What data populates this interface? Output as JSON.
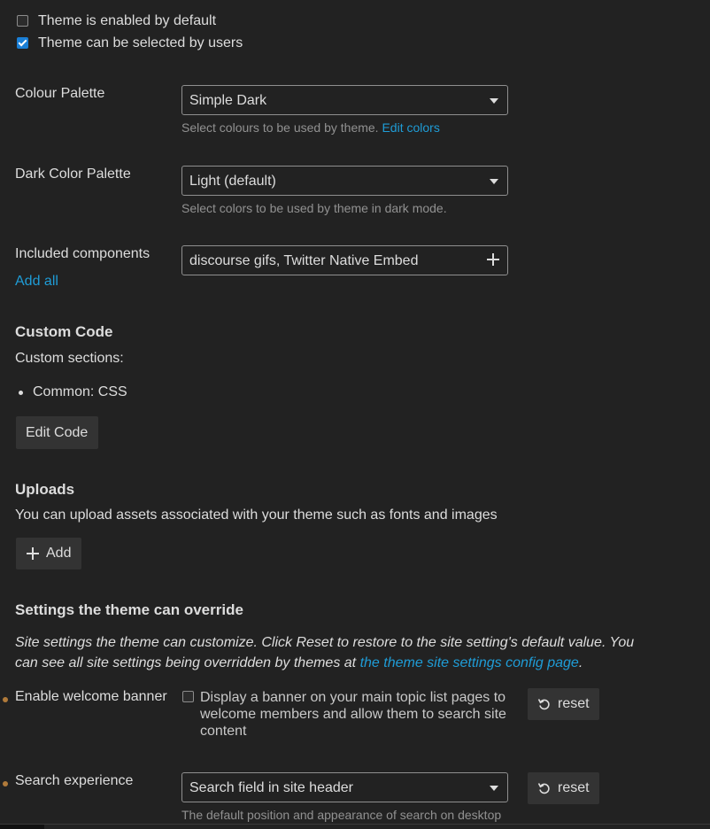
{
  "checkboxes": {
    "enabled_default": {
      "label": "Theme is enabled by default",
      "checked": false
    },
    "selectable": {
      "label": "Theme can be selected by users",
      "checked": true
    }
  },
  "colour_palette": {
    "label": "Colour Palette",
    "value": "Simple Dark",
    "help": "Select colours to be used by theme.",
    "help_link": "Edit colors"
  },
  "dark_palette": {
    "label": "Dark Color Palette",
    "value": "Light (default)",
    "help": "Select colors to be used by theme in dark mode."
  },
  "components": {
    "label": "Included components",
    "add_all": "Add all",
    "value": "discourse gifs, Twitter Native Embed"
  },
  "custom_code": {
    "heading": "Custom Code",
    "sections_label": "Custom sections:",
    "sections": [
      "Common: CSS"
    ],
    "edit_button": "Edit Code"
  },
  "uploads": {
    "heading": "Uploads",
    "description": "You can upload assets associated with your theme such as fonts and images",
    "add_button": "Add"
  },
  "overrides": {
    "heading": "Settings the theme can override",
    "description_1": "Site settings the theme can customize. Click Reset to restore to the site setting's default value. You",
    "description_2": "can see all site settings being overridden by themes at",
    "description_link": "the theme site settings config page",
    "description_end": ".",
    "welcome": {
      "label": "Enable welcome banner",
      "checkbox_line1": "Display a banner on your main topic list pages to",
      "checkbox_line2": "welcome members and allow them to search site",
      "checkbox_line3": "content",
      "checked": false,
      "reset": "reset"
    },
    "search": {
      "label": "Search experience",
      "value": "Search field in site header",
      "help": "The default position and appearance of search on desktop",
      "reset": "reset"
    }
  },
  "colors": {
    "background": "#222222",
    "text": "#dddddd",
    "muted": "#919191",
    "link": "#1f9cd6",
    "button": "#333333",
    "accent_dot": "#b07a3a"
  }
}
